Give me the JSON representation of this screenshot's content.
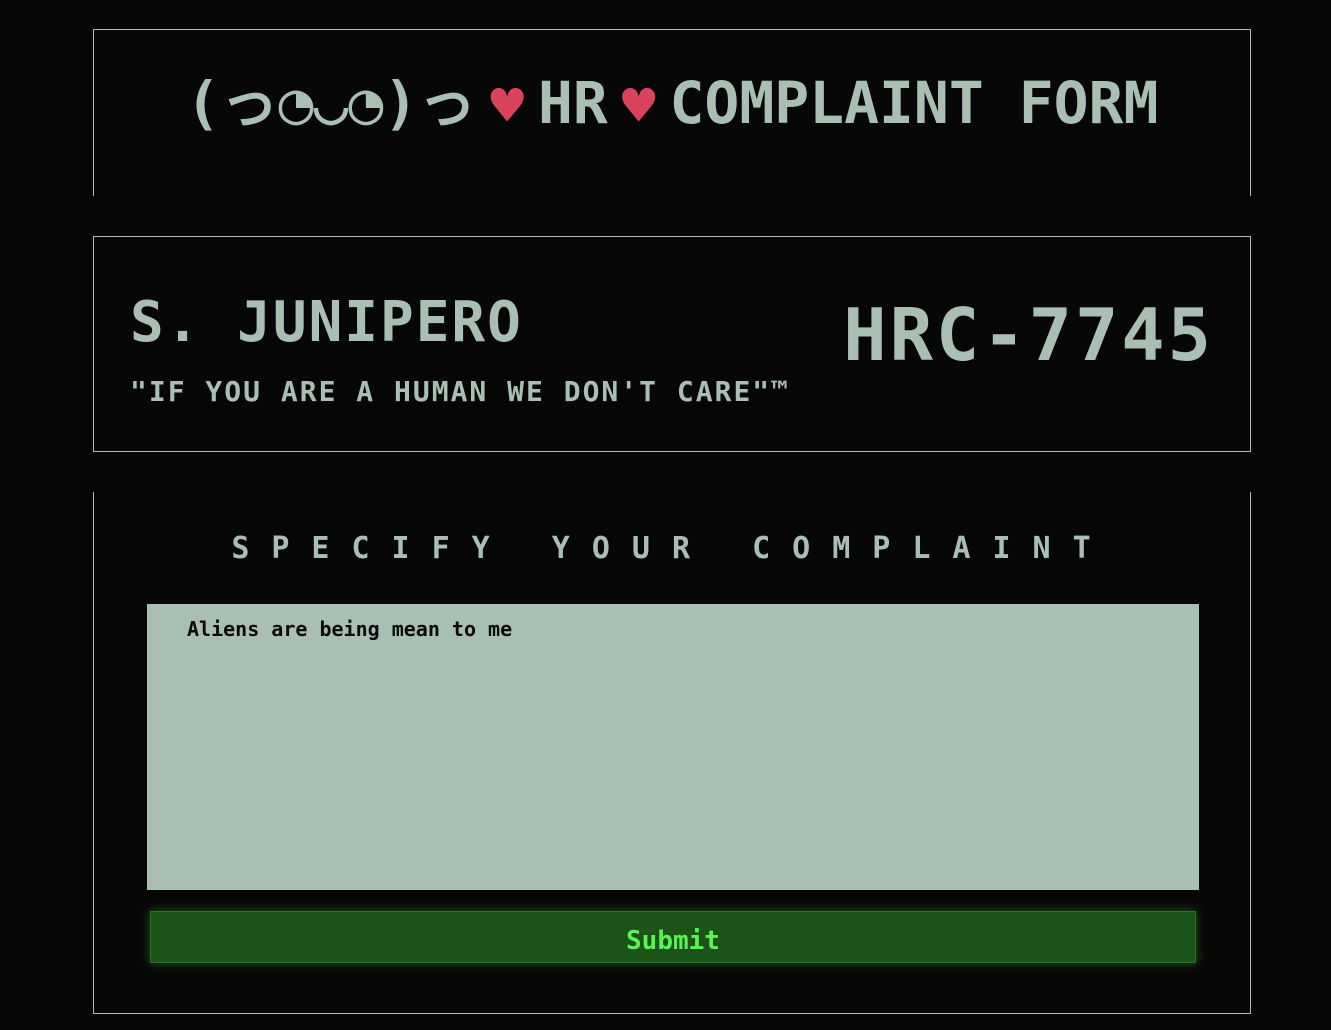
{
  "header": {
    "face_left": "(っ◔◡◔)っ",
    "heart_icon": "♥",
    "hr_label": "HR",
    "title": "COMPLAINT FORM"
  },
  "employee": {
    "name": "S. JUNIPERO",
    "slogan": "\"IF YOU ARE A HUMAN WE DON'T CARE\"™",
    "case_id": "HRC-7745"
  },
  "complaint": {
    "heading": "SPECIFY YOUR COMPLAINT",
    "text": "Aliens are being mean to me",
    "submit_label": "Submit"
  },
  "colors": {
    "background": "#080708",
    "foreground": "#a9bfb4",
    "heart": "#d9435b",
    "submit_bg": "#1c5318",
    "submit_text": "#5cf155"
  }
}
